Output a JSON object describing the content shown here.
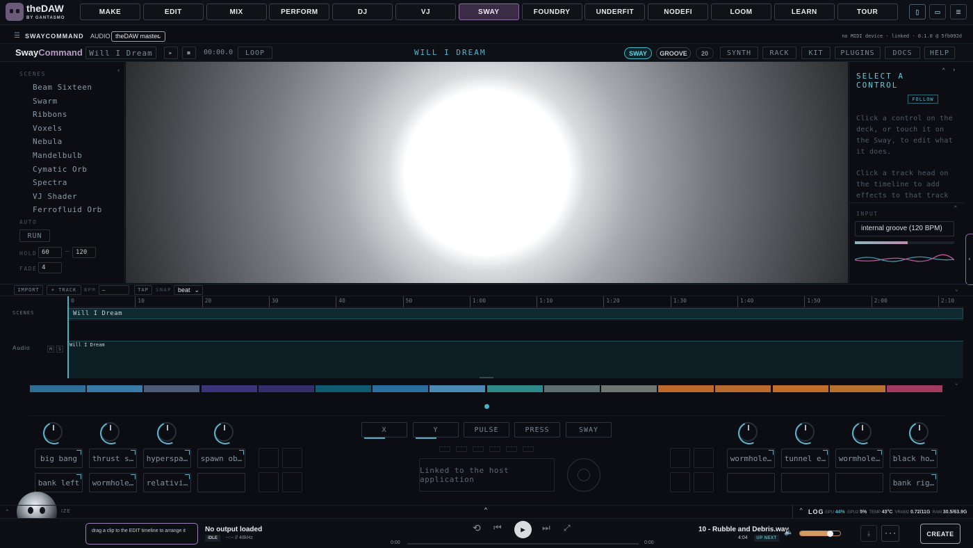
{
  "app": {
    "name": "theDAW",
    "byline": "BY GANTASMO"
  },
  "nav": [
    "MAKE",
    "EDIT",
    "MIX",
    "PERFORM",
    "DJ",
    "VJ",
    "SWAY",
    "FOUNDRY",
    "UNDERFIT",
    "NODEFI",
    "LOOM",
    "LEARN",
    "TOUR"
  ],
  "bar2": {
    "title": "SWAYCOMMAND",
    "audio_label": "AUDIO",
    "audio_select": "theDAW master",
    "status": "no MIDI device · linked · 0.1.0 @ 5fb092d"
  },
  "bar3": {
    "brand_a": "Sway",
    "brand_b": "Command",
    "clip_name": "Will I Dream",
    "time": "00:00.0",
    "loop": "LOOP",
    "title": "WILL I DREAM",
    "sway": "SWAY",
    "groove": "GROOVE",
    "count": "20",
    "tabs": [
      "SYNTH",
      "RACK",
      "KIT",
      "PLUGINS",
      "DOCS",
      "HELP"
    ]
  },
  "left": {
    "scenes_label": "SCENES",
    "scenes": [
      "Beam Sixteen",
      "Swarm",
      "Ribbons",
      "Voxels",
      "Nebula",
      "Mandelbulb",
      "Cymatic Orb",
      "Spectra",
      "VJ Shader",
      "Ferrofluid Orb"
    ],
    "auto": "AUTO",
    "run": "RUN",
    "hold": "HOLD",
    "hold_a": "60",
    "hold_b": "120",
    "fade": "FADE",
    "fade_v": "4"
  },
  "right": {
    "title": "SELECT A CONTROL",
    "follow": "FOLLOW",
    "help1": "Click a control on the deck, or touch it on the Sway, to edit what it does.",
    "help2": "Click a track head on the timeline to add effects to that track",
    "input_label": "INPUT",
    "input_value": "internal groove (120 BPM)"
  },
  "timeline": {
    "import": "IMPORT",
    "track": "+ TRACK",
    "bpm": "BPM",
    "bpm_value": "—",
    "tap": "TAP",
    "snap": "SNAP",
    "snap_value": "beat",
    "ticks": [
      "0",
      "10",
      "20",
      "30",
      "40",
      "50",
      "1:00",
      "1:10",
      "1:20",
      "1:30",
      "1:40",
      "1:50",
      "2:00",
      "2:10"
    ],
    "scenes_label": "SCENES",
    "scene_clip": "Will I Dream",
    "audio_label": "Audio",
    "m": "M",
    "s": "S",
    "audio_clip": "Will I Dream"
  },
  "swatches": [
    "#2e6e96",
    "#3a7aa6",
    "#4a5a78",
    "#3c3478",
    "#342e6a",
    "#0e5a6e",
    "#2a6ea0",
    "#4a8ab4",
    "#2e8a8a",
    "#5e6e6e",
    "#6e7672",
    "#c0682a",
    "#b86a2e",
    "#c06c2a",
    "#b8702e",
    "#a43a5e"
  ],
  "deck": {
    "modes": [
      "X",
      "Y",
      "PULSE",
      "PRESS",
      "SWAY"
    ],
    "left_pads": [
      "big bang",
      "thrust s…",
      "hyperspa…",
      "spawn ob…",
      "bank left",
      "wormhole…",
      "relativi…",
      ""
    ],
    "right_pads": [
      "wormhole…",
      "tunnel e…",
      "wormhole…",
      "black ho…",
      "",
      "",
      "",
      "bank rig…"
    ],
    "center_text": "Linked to the host application"
  },
  "status": {
    "left_txt": "IZE",
    "log": "LOG",
    "gpu_l": "GPU",
    "gpu": "44%",
    "gpu2_l": "GPU2",
    "gpu2": "5%",
    "temp_l": "TEMP",
    "temp": "43°C",
    "vram_l": "VRAM2",
    "vram": "0.72/11G",
    "ram_l": "RAM",
    "ram": "30.5/63.9G"
  },
  "player": {
    "hint": "drag a clip to the EDIT timeline to arrange it",
    "output": "No output loaded",
    "idle": "IDLE",
    "format": "--:-- // 48kHz",
    "t0": "0:00",
    "t1": "0:00",
    "track": "10 - Rubble and Debris.wav",
    "duration": "4:04",
    "upnext": "UP NEXT",
    "volume": 0.75,
    "create": "CREATE"
  }
}
